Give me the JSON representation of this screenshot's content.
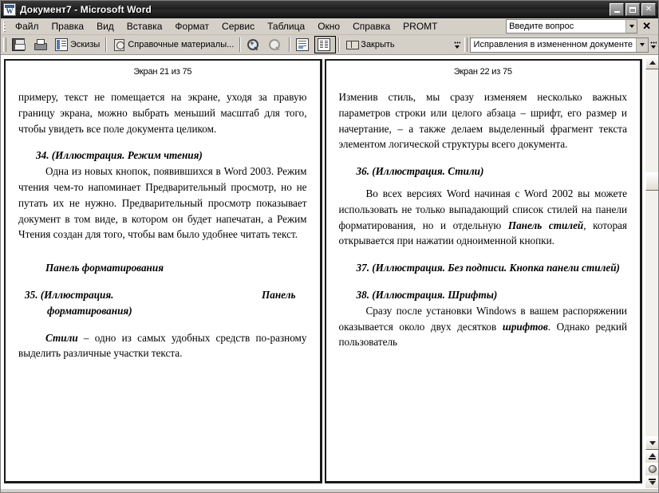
{
  "window": {
    "title": "Документ7 - Microsoft Word",
    "icon": "word-document-icon",
    "minimize_label": "_",
    "maximize_label": "□",
    "close_label": "✕"
  },
  "menubar": {
    "items": [
      {
        "label": "Файл"
      },
      {
        "label": "Правка"
      },
      {
        "label": "Вид"
      },
      {
        "label": "Вставка"
      },
      {
        "label": "Формат"
      },
      {
        "label": "Сервис"
      },
      {
        "label": "Таблица"
      },
      {
        "label": "Окно"
      },
      {
        "label": "Справка"
      },
      {
        "label": "PROMT"
      }
    ],
    "ask_a_question": {
      "value": "Введите вопрос",
      "placeholder": "Введите вопрос"
    },
    "close_label": "✕"
  },
  "toolbar": {
    "buttons": [
      {
        "name": "save-button",
        "icon": "save-icon",
        "label": ""
      },
      {
        "name": "print-button",
        "icon": "print-icon",
        "label": ""
      },
      {
        "name": "thumbnails-button",
        "icon": "thumbnails-icon",
        "label": "Эскизы"
      },
      {
        "name": "research-button",
        "icon": "research-icon",
        "label": "Справочные материалы..."
      },
      {
        "name": "zoom-in-button",
        "icon": "zoom-in-icon",
        "label": ""
      },
      {
        "name": "zoom-out-button",
        "icon": "zoom-out-icon",
        "label": ""
      },
      {
        "name": "actual-page-button",
        "icon": "one-page-icon",
        "label": ""
      },
      {
        "name": "two-pages-button",
        "icon": "two-page-icon",
        "label": ""
      },
      {
        "name": "close-reading-button",
        "icon": "close-book-icon",
        "label": "Закрыть"
      }
    ],
    "revisions_dropdown": {
      "value": "Исправления в измененном документе"
    }
  },
  "document": {
    "left_page": {
      "header": "Экран 21 из 75",
      "blocks": [
        {
          "type": "justify",
          "text": "примеру, текст не помещается на экране, уходя за правую границу экрана, можно выбрать меньший масштаб для того, чтобы увидеть все поле документа целиком."
        },
        {
          "type": "spacer"
        },
        {
          "type": "heading",
          "text": "34. (Иллюстрация. Режим чтения)"
        },
        {
          "type": "indent",
          "text": "Одна из новых кнопок, появившихся в Word 2003. Режим чтения чем-то напоминает Предварительный просмотр, но не путать их не нужно. Предварительный просмотр показывает документ в том виде, в котором он будет напечатан, а Режим Чтения создан для того, чтобы вам было удобнее читать текст."
        },
        {
          "type": "spacer"
        },
        {
          "type": "spacer"
        },
        {
          "type": "subheading",
          "text": "Панель форматирования"
        },
        {
          "type": "spacer"
        },
        {
          "type": "heading_spread",
          "text": "35. (Иллюстрация.",
          "text_right": "Панель",
          "text_cont": "форматирования)"
        },
        {
          "type": "spacer"
        },
        {
          "type": "indent_rich",
          "bold_italic": "Стили",
          "text": " – одно из самых удобных средств по-разному выделить различные участки текста."
        }
      ]
    },
    "right_page": {
      "header": "Экран 22 из 75",
      "blocks": [
        {
          "type": "justify",
          "text": "Изменив стиль, мы сразу изменяем несколько важных параметров строки или целого абзаца – шрифт, его размер и начертание, – а также делаем выделенный фрагмент текста элементом логической структуры всего документа."
        },
        {
          "type": "spacer"
        },
        {
          "type": "heading",
          "text": "36. (Иллюстрация. Стили)"
        },
        {
          "type": "spacer"
        },
        {
          "type": "indent_rich2",
          "pre": "Во всех версиях Word начиная с Word 2002 вы можете использовать не только выпадающий список стилей на панели форматирования, но и отдельную ",
          "bold_italic": "Панель стилей",
          "post": ", которая открывается при нажатии одноименной кнопки."
        },
        {
          "type": "spacer"
        },
        {
          "type": "heading_hang",
          "text": "37. (Иллюстрация. Без подписи. Кнопка панели стилей)"
        },
        {
          "type": "spacer"
        },
        {
          "type": "heading",
          "text": "38. (Иллюстрация. Шрифты)"
        },
        {
          "type": "indent_rich3",
          "pre": "Сразу после установки Windows в вашем распоряжении оказывается около двух десятков ",
          "bold_italic": "шрифтов",
          "post": ".  Однако    редкий    пользователь"
        }
      ]
    }
  },
  "scrollbar": {
    "up_arrow": "▲",
    "down_arrow": "▼",
    "prev_page_label": "Предыдущая страница",
    "select_object_label": "Выбор объекта перехода",
    "next_page_label": "Следующая страница",
    "thumb_top_pct": 28,
    "thumb_height_pct": 5
  },
  "colors": {
    "window_chrome": "#d4d0c8",
    "titlebar": "#1f1f1f",
    "page_background": "#ffffff",
    "page_border": "#1a1a1a",
    "scrollbar_track": "#f3f1ec"
  }
}
